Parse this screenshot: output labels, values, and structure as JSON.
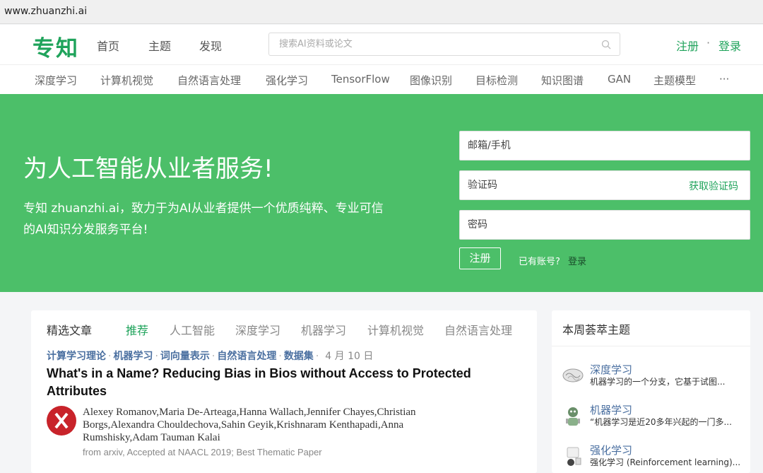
{
  "browser": {
    "url": "www.zhuanzhi.ai"
  },
  "header": {
    "logo": "专知",
    "nav": [
      "首页",
      "主题",
      "发现"
    ],
    "search_placeholder": "搜索AI资料或论文",
    "register": "注册",
    "dot": "·",
    "login": "登录",
    "brand_color": "#1fa35b"
  },
  "categories": [
    "深度学习",
    "计算机视觉",
    "自然语言处理",
    "强化学习",
    "TensorFlow",
    "图像识别",
    "目标检测",
    "知识图谱",
    "GAN",
    "主题模型",
    "···"
  ],
  "hero": {
    "title": "为人工智能从业者服务!",
    "description": "专知 zhuanzhi.ai，致力于为AI从业者提供一个优质纯粹、专业可信的AI知识分发服务平台!",
    "email_placeholder": "邮箱/手机",
    "code_placeholder": "验证码",
    "get_code": "获取验证码",
    "password_placeholder": "密码",
    "register_button": "注册",
    "has_account": "已有账号?",
    "login_link": "登录",
    "bg_color": "#4cbf69"
  },
  "articles": {
    "title": "精选文章",
    "tabs": [
      "推荐",
      "人工智能",
      "深度学习",
      "机器学习",
      "计算机视觉",
      "自然语言处理"
    ],
    "active_tab": "推荐",
    "item": {
      "tags": [
        "计算学习理论",
        "机器学习",
        "词向量表示",
        "自然语言处理",
        "数据集"
      ],
      "date": "4 月 10 日",
      "title": "What's in a Name? Reducing Bias in Bios without Access to Protected Attributes",
      "authors": "Alexey Romanov,Maria De-Arteaga,Hanna Wallach,Jennifer Chayes,Christian Borgs,Alexandra Chouldechova,Sahin Geyik,Krishnaram Kenthapadi,Anna Rumshisky,Adam Tauman Kalai",
      "source": "from arxiv, Accepted at NAACL 2019; Best Thematic Paper"
    }
  },
  "topics": {
    "title": "本周荟萃主题",
    "items": [
      {
        "name": "深度学习",
        "desc": "机器学习的一个分支，它基于试图...",
        "icon": "brain-icon"
      },
      {
        "name": "机器学习",
        "desc": "“机器学习是近20多年兴起的一门多...",
        "icon": "robot-icon"
      },
      {
        "name": "强化学习",
        "desc": "强化学习 (Reinforcement learning)...",
        "icon": "agent-icon"
      }
    ]
  }
}
